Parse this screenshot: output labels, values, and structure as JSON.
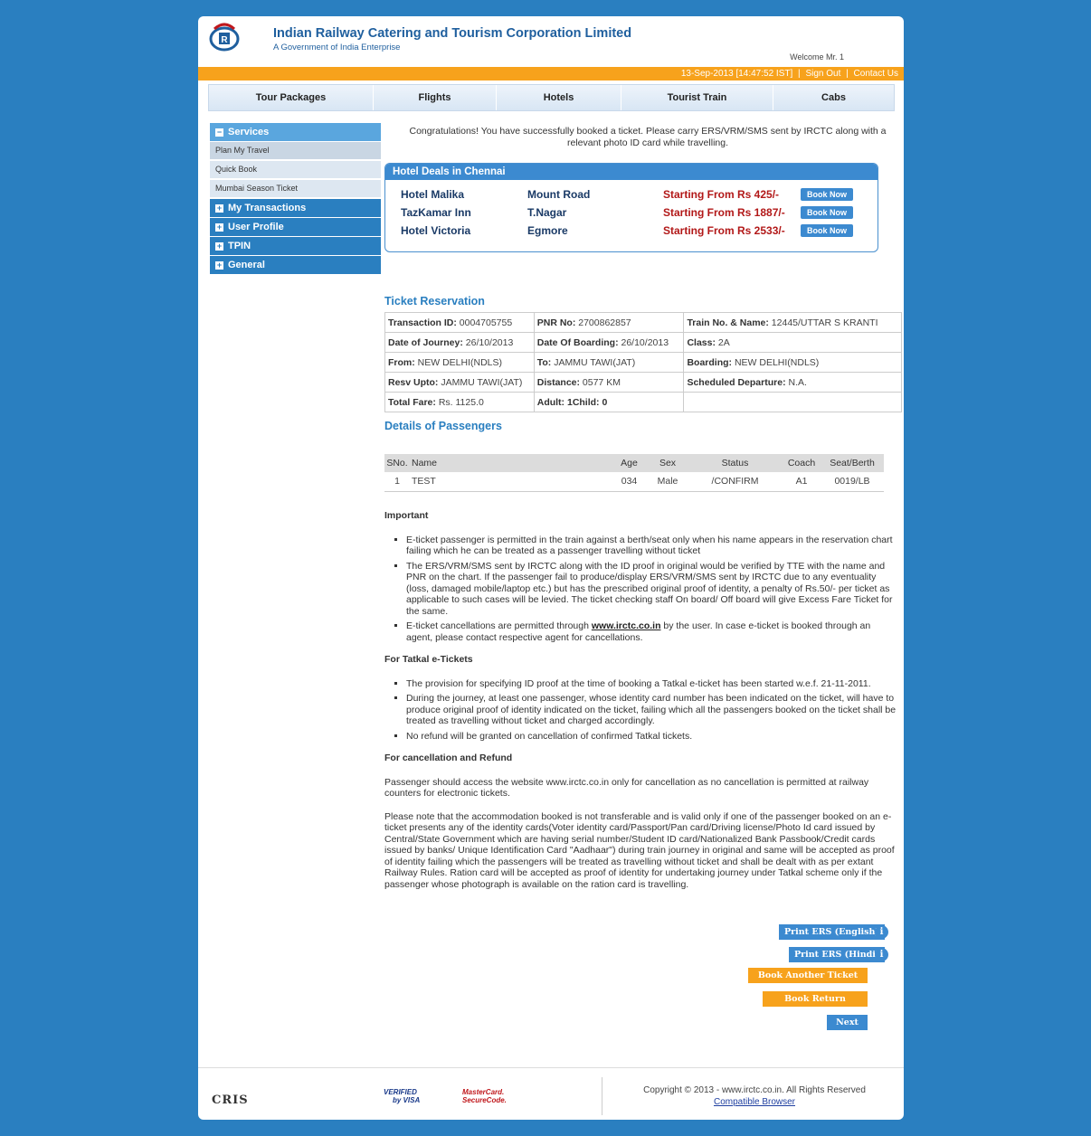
{
  "header": {
    "org_name": "Indian Railway Catering and Tourism Corporation Limited",
    "org_sub": "A Government of India Enterprise",
    "welcome": "Welcome Mr. 1",
    "datetime": "13-Sep-2013 [14:47:52 IST]",
    "sign_out": "Sign Out",
    "contact_us": "Contact Us"
  },
  "nav": [
    "Tour Packages",
    "Flights",
    "Hotels",
    "Tourist Train",
    "Cabs"
  ],
  "sidebar": {
    "services": "Services",
    "sub": [
      "Plan My Travel",
      "Quick Book",
      "Mumbai Season Ticket"
    ],
    "sections": [
      "My Transactions",
      "User Profile",
      "TPIN",
      "General"
    ]
  },
  "congrats": "Congratulations! You have successfully booked a ticket. Please carry ERS/VRM/SMS sent by IRCTC along with a relevant photo ID card while travelling.",
  "deals": {
    "title": "Hotel Deals in Chennai",
    "book_now": "Book Now",
    "items": [
      {
        "hotel": "Hotel Malika",
        "area": "Mount Road",
        "price": "Starting From Rs 425/-"
      },
      {
        "hotel": "TazKamar Inn",
        "area": "T.Nagar",
        "price": "Starting From Rs 1887/-"
      },
      {
        "hotel": "Hotel Victoria",
        "area": "Egmore",
        "price": "Starting From Rs 2533/-"
      }
    ]
  },
  "ticket": {
    "title": "Ticket Reservation",
    "rows": [
      [
        {
          "k": "Transaction ID:",
          "v": " 0004705755"
        },
        {
          "k": "PNR No:",
          "v": " 2700862857"
        },
        {
          "k": "Train No. & Name:",
          "v": " 12445/UTTAR S KRANTI"
        }
      ],
      [
        {
          "k": "Date of Journey:",
          "v": " 26/10/2013"
        },
        {
          "k": "Date Of Boarding:",
          "v": " 26/10/2013"
        },
        {
          "k": "Class:",
          "v": " 2A"
        }
      ],
      [
        {
          "k": "From:",
          "v": " NEW DELHI(NDLS)"
        },
        {
          "k": "To:",
          "v": " JAMMU TAWI(JAT)"
        },
        {
          "k": "Boarding:",
          "v": " NEW DELHI(NDLS)"
        }
      ],
      [
        {
          "k": "Resv Upto:",
          "v": " JAMMU TAWI(JAT)"
        },
        {
          "k": "Distance:",
          "v": " 0577 KM"
        },
        {
          "k": "Scheduled Departure:",
          "v": " N.A."
        }
      ],
      [
        {
          "k": "Total Fare:",
          "v": " Rs. 1125.0"
        },
        {
          "k": "Adult: 1",
          "v": "Child: 0"
        },
        {
          "k": "",
          "v": ""
        }
      ]
    ]
  },
  "passengers": {
    "title": "Details of Passengers",
    "headers": [
      "SNo.",
      "Name",
      "Age",
      "Sex",
      "Status",
      "Coach",
      "Seat/Berth"
    ],
    "rows": [
      [
        "1",
        "TEST",
        "034",
        "Male",
        "/CONFIRM",
        "A1",
        "0019/LB"
      ]
    ]
  },
  "important": {
    "h1": "Important",
    "list1": [
      "E-ticket passenger is permitted in the train against a berth/seat only when his name appears in the reservation chart failing which he can be treated as a passenger travelling without ticket",
      "The ERS/VRM/SMS sent by IRCTC along with the ID proof in original would be verified by TTE with the name and PNR on the chart. If the passenger fail to produce/display ERS/VRM/SMS sent by IRCTC due to any eventuality (loss, damaged mobile/laptop etc.) but has the prescribed original proof of identity, a penalty of Rs.50/- per ticket as applicable to such cases will be levied. The ticket checking staff On board/ Off board will give Excess Fare Ticket for the same."
    ],
    "cancel_pre": "E-ticket cancellations are permitted through ",
    "cancel_link": "www.irctc.co.in",
    "cancel_post": " by the user. In case e-ticket is booked through an agent, please contact respective agent for cancellations.",
    "h2": "For Tatkal e-Tickets",
    "list2": [
      "The provision for specifying ID proof at the time of booking a Tatkal e-ticket has been started w.e.f. 21-11-2011.",
      "During the journey, at least one passenger, whose identity card number has been indicated on the ticket, will have to produce original proof of identity indicated on the ticket, failing which all the passengers booked on the ticket shall be treated as travelling without ticket and charged accordingly.",
      "No refund will be granted on cancellation of confirmed Tatkal tickets."
    ],
    "h3": "For cancellation and Refund",
    "p1": "Passenger should access the website www.irctc.co.in only for cancellation as no cancellation is permitted at railway counters for electronic tickets.",
    "p2": "Please note that the accommodation booked is not transferable and is valid only if one of the passenger booked on an e-ticket presents any of the identity cards(Voter identity card/Passport/Pan card/Driving license/Photo Id card issued by Central/State Government which are having serial number/Student ID card/Nationalized Bank Passbook/Credit cards issued by banks/ Unique Identification Card \"Aadhaar\") during train journey in original and same will be accepted as proof of identity failing which the passengers will be treated as travelling without ticket and shall be dealt with as per extant Railway Rules. Ration card will be accepted as proof of identity for undertaking journey under Tatkal scheme only if the passenger whose photograph is available on the ration card is travelling."
  },
  "buttons": {
    "print_en": "Print ERS (English)",
    "print_hi": "Print ERS (Hindi)",
    "info": "i",
    "book_another": "Book Another Ticket",
    "book_return": "Book Return Ticket",
    "next": "Next"
  },
  "footer": {
    "cris": "CRIS",
    "visa_1": "VERIFIED",
    "visa_2": "by VISA",
    "mc_1": "MasterCard.",
    "mc_2": "SecureCode.",
    "copyright": "Copyright © 2013 - www.irctc.co.in. All Rights Reserved",
    "browser": "Compatible Browser"
  },
  "colors": {
    "brand_blue": "#2a7fc0",
    "orange": "#f7a21c",
    "price_red": "#b21818"
  }
}
